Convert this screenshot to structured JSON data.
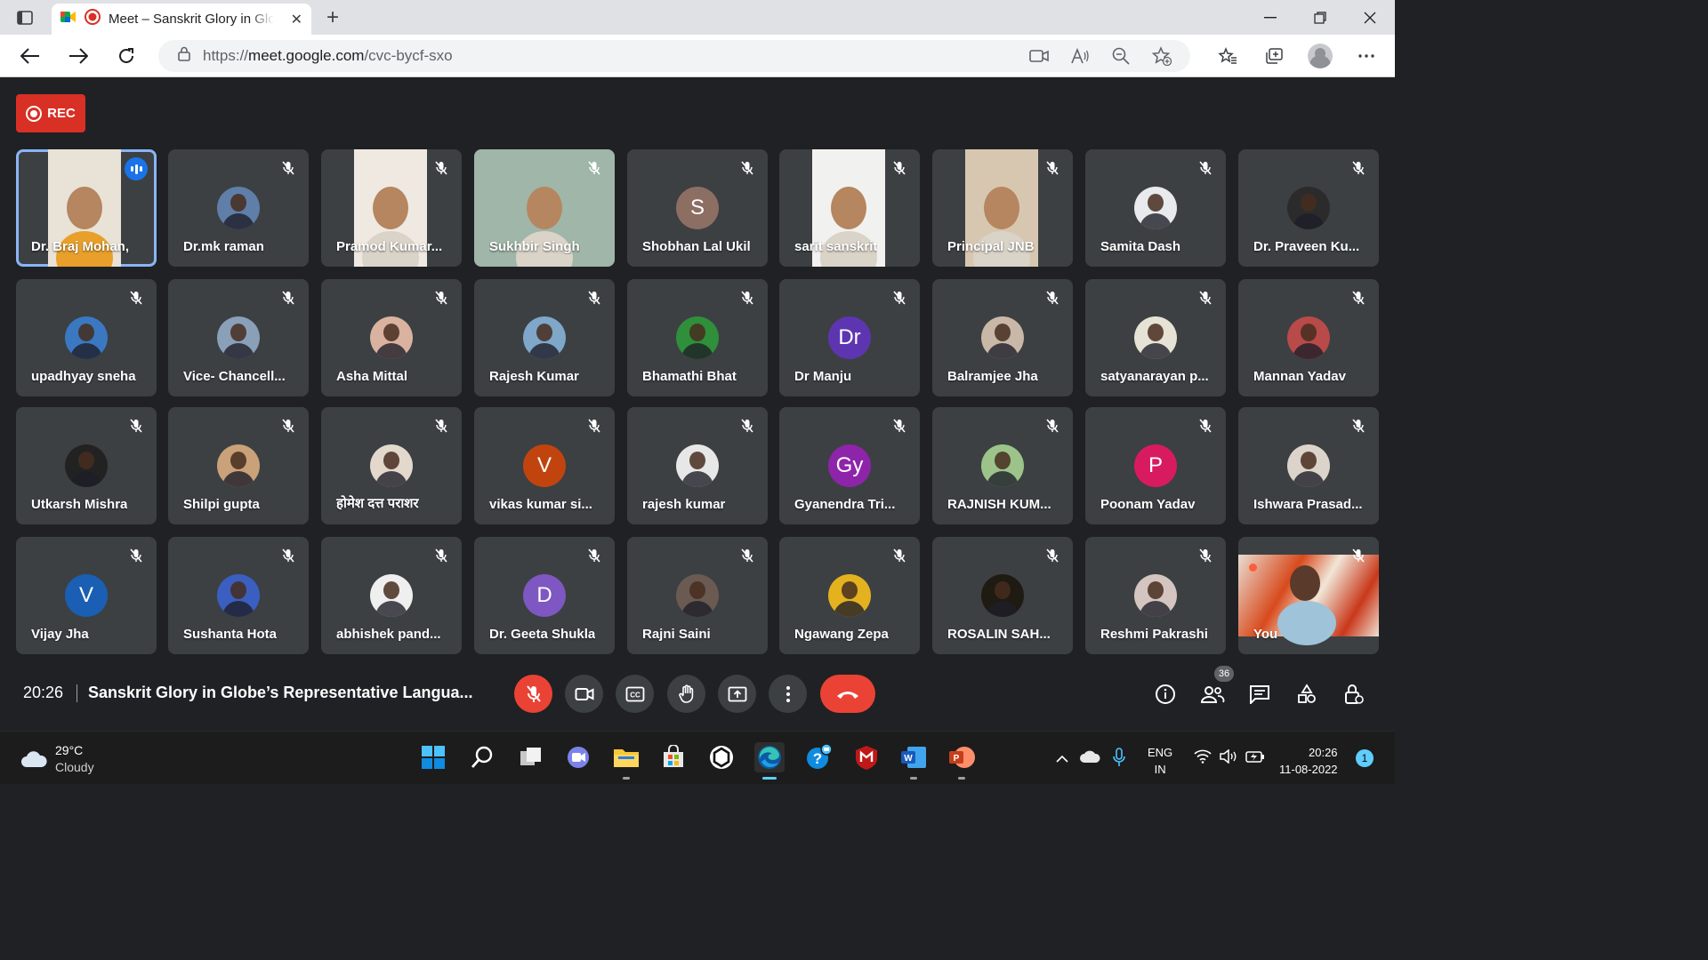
{
  "browser": {
    "tab_title": "Meet – Sanskrit Glory in Globe's Representative Language",
    "url_protocol": "https://",
    "url_host": "meet.google.com",
    "url_path": "/cvc-bycf-sxo",
    "close_tab": "✕",
    "new_tab": "+"
  },
  "meet": {
    "rec_label": "REC",
    "time": "20:26",
    "meeting_title": "Sanskrit Glory in Globe’s Representative Langua...",
    "participant_count": "36",
    "participants": [
      {
        "name": "Dr. Braj Mohan,",
        "type": "video",
        "speaking": true
      },
      {
        "name": "Dr.mk raman",
        "type": "photo",
        "color": "#5f7fa8"
      },
      {
        "name": "Pramod Kumar...",
        "type": "video"
      },
      {
        "name": "Sukhbir Singh",
        "type": "video"
      },
      {
        "name": "Shobhan Lal Ukil",
        "type": "initial",
        "initial": "S",
        "color": "#8d6e63"
      },
      {
        "name": "sarit sanskrit",
        "type": "video"
      },
      {
        "name": "Principal JNB",
        "type": "video"
      },
      {
        "name": "Samita Dash",
        "type": "photo",
        "color": "#e8eaed"
      },
      {
        "name": "Dr. Praveen Ku...",
        "type": "photo",
        "color": "#2b2b2b"
      },
      {
        "name": "upadhyay sneha",
        "type": "photo",
        "color": "#3a78c2"
      },
      {
        "name": "Vice- Chancell...",
        "type": "photo",
        "color": "#8aa0b8"
      },
      {
        "name": "Asha Mittal",
        "type": "photo",
        "color": "#d9b3a0"
      },
      {
        "name": "Rajesh Kumar",
        "type": "photo",
        "color": "#7ea7c9"
      },
      {
        "name": "Bhamathi Bhat",
        "type": "photo",
        "color": "#2f8f3a"
      },
      {
        "name": "Dr Manju",
        "type": "initial",
        "initial": "Dr",
        "color": "#5e35b1"
      },
      {
        "name": "Balramjee Jha",
        "type": "photo",
        "color": "#c9b8a8"
      },
      {
        "name": "satyanarayan p...",
        "type": "photo",
        "color": "#e6e2d6"
      },
      {
        "name": "Mannan Yadav",
        "type": "photo",
        "color": "#b84a4a"
      },
      {
        "name": "Utkarsh Mishra",
        "type": "photo",
        "color": "#222222"
      },
      {
        "name": "Shilpi gupta",
        "type": "photo",
        "color": "#c9a27a"
      },
      {
        "name": "होमेश दत्त पराशर",
        "type": "photo",
        "color": "#e2d8cc"
      },
      {
        "name": "vikas kumar si...",
        "type": "initial",
        "initial": "V",
        "color": "#c1440e"
      },
      {
        "name": "rajesh kumar",
        "type": "photo",
        "color": "#e7e7e7"
      },
      {
        "name": "Gyanendra Tri...",
        "type": "initial",
        "initial": "Gy",
        "color": "#8e24aa"
      },
      {
        "name": "RAJNISH KUM...",
        "type": "photo",
        "color": "#9cc48a"
      },
      {
        "name": "Poonam Yadav",
        "type": "initial",
        "initial": "P",
        "color": "#d81b60"
      },
      {
        "name": "Ishwara Prasad...",
        "type": "photo",
        "color": "#dcd3cb"
      },
      {
        "name": "Vijay Jha",
        "type": "initial",
        "initial": "V",
        "color": "#1a5fb4"
      },
      {
        "name": "Sushanta Hota",
        "type": "photo",
        "color": "#3b5fc0"
      },
      {
        "name": "abhishek pand...",
        "type": "photo",
        "color": "#efefef"
      },
      {
        "name": "Dr. Geeta Shukla",
        "type": "initial",
        "initial": "D",
        "color": "#7e57c2"
      },
      {
        "name": "Rajni Saini",
        "type": "photo",
        "color": "#6a5a52"
      },
      {
        "name": "Ngawang Zepa",
        "type": "photo",
        "color": "#e4b21f"
      },
      {
        "name": "ROSALIN SAH...",
        "type": "photo",
        "color": "#1f1a12"
      },
      {
        "name": "Reshmi Pakrashi",
        "type": "photo",
        "color": "#d4c5c0"
      },
      {
        "name": "You",
        "type": "self"
      }
    ]
  },
  "taskbar": {
    "temperature": "29°C",
    "condition": "Cloudy",
    "lang": "ENG",
    "region": "IN",
    "time": "20:26",
    "date": "11-08-2022",
    "notifications": "1"
  }
}
